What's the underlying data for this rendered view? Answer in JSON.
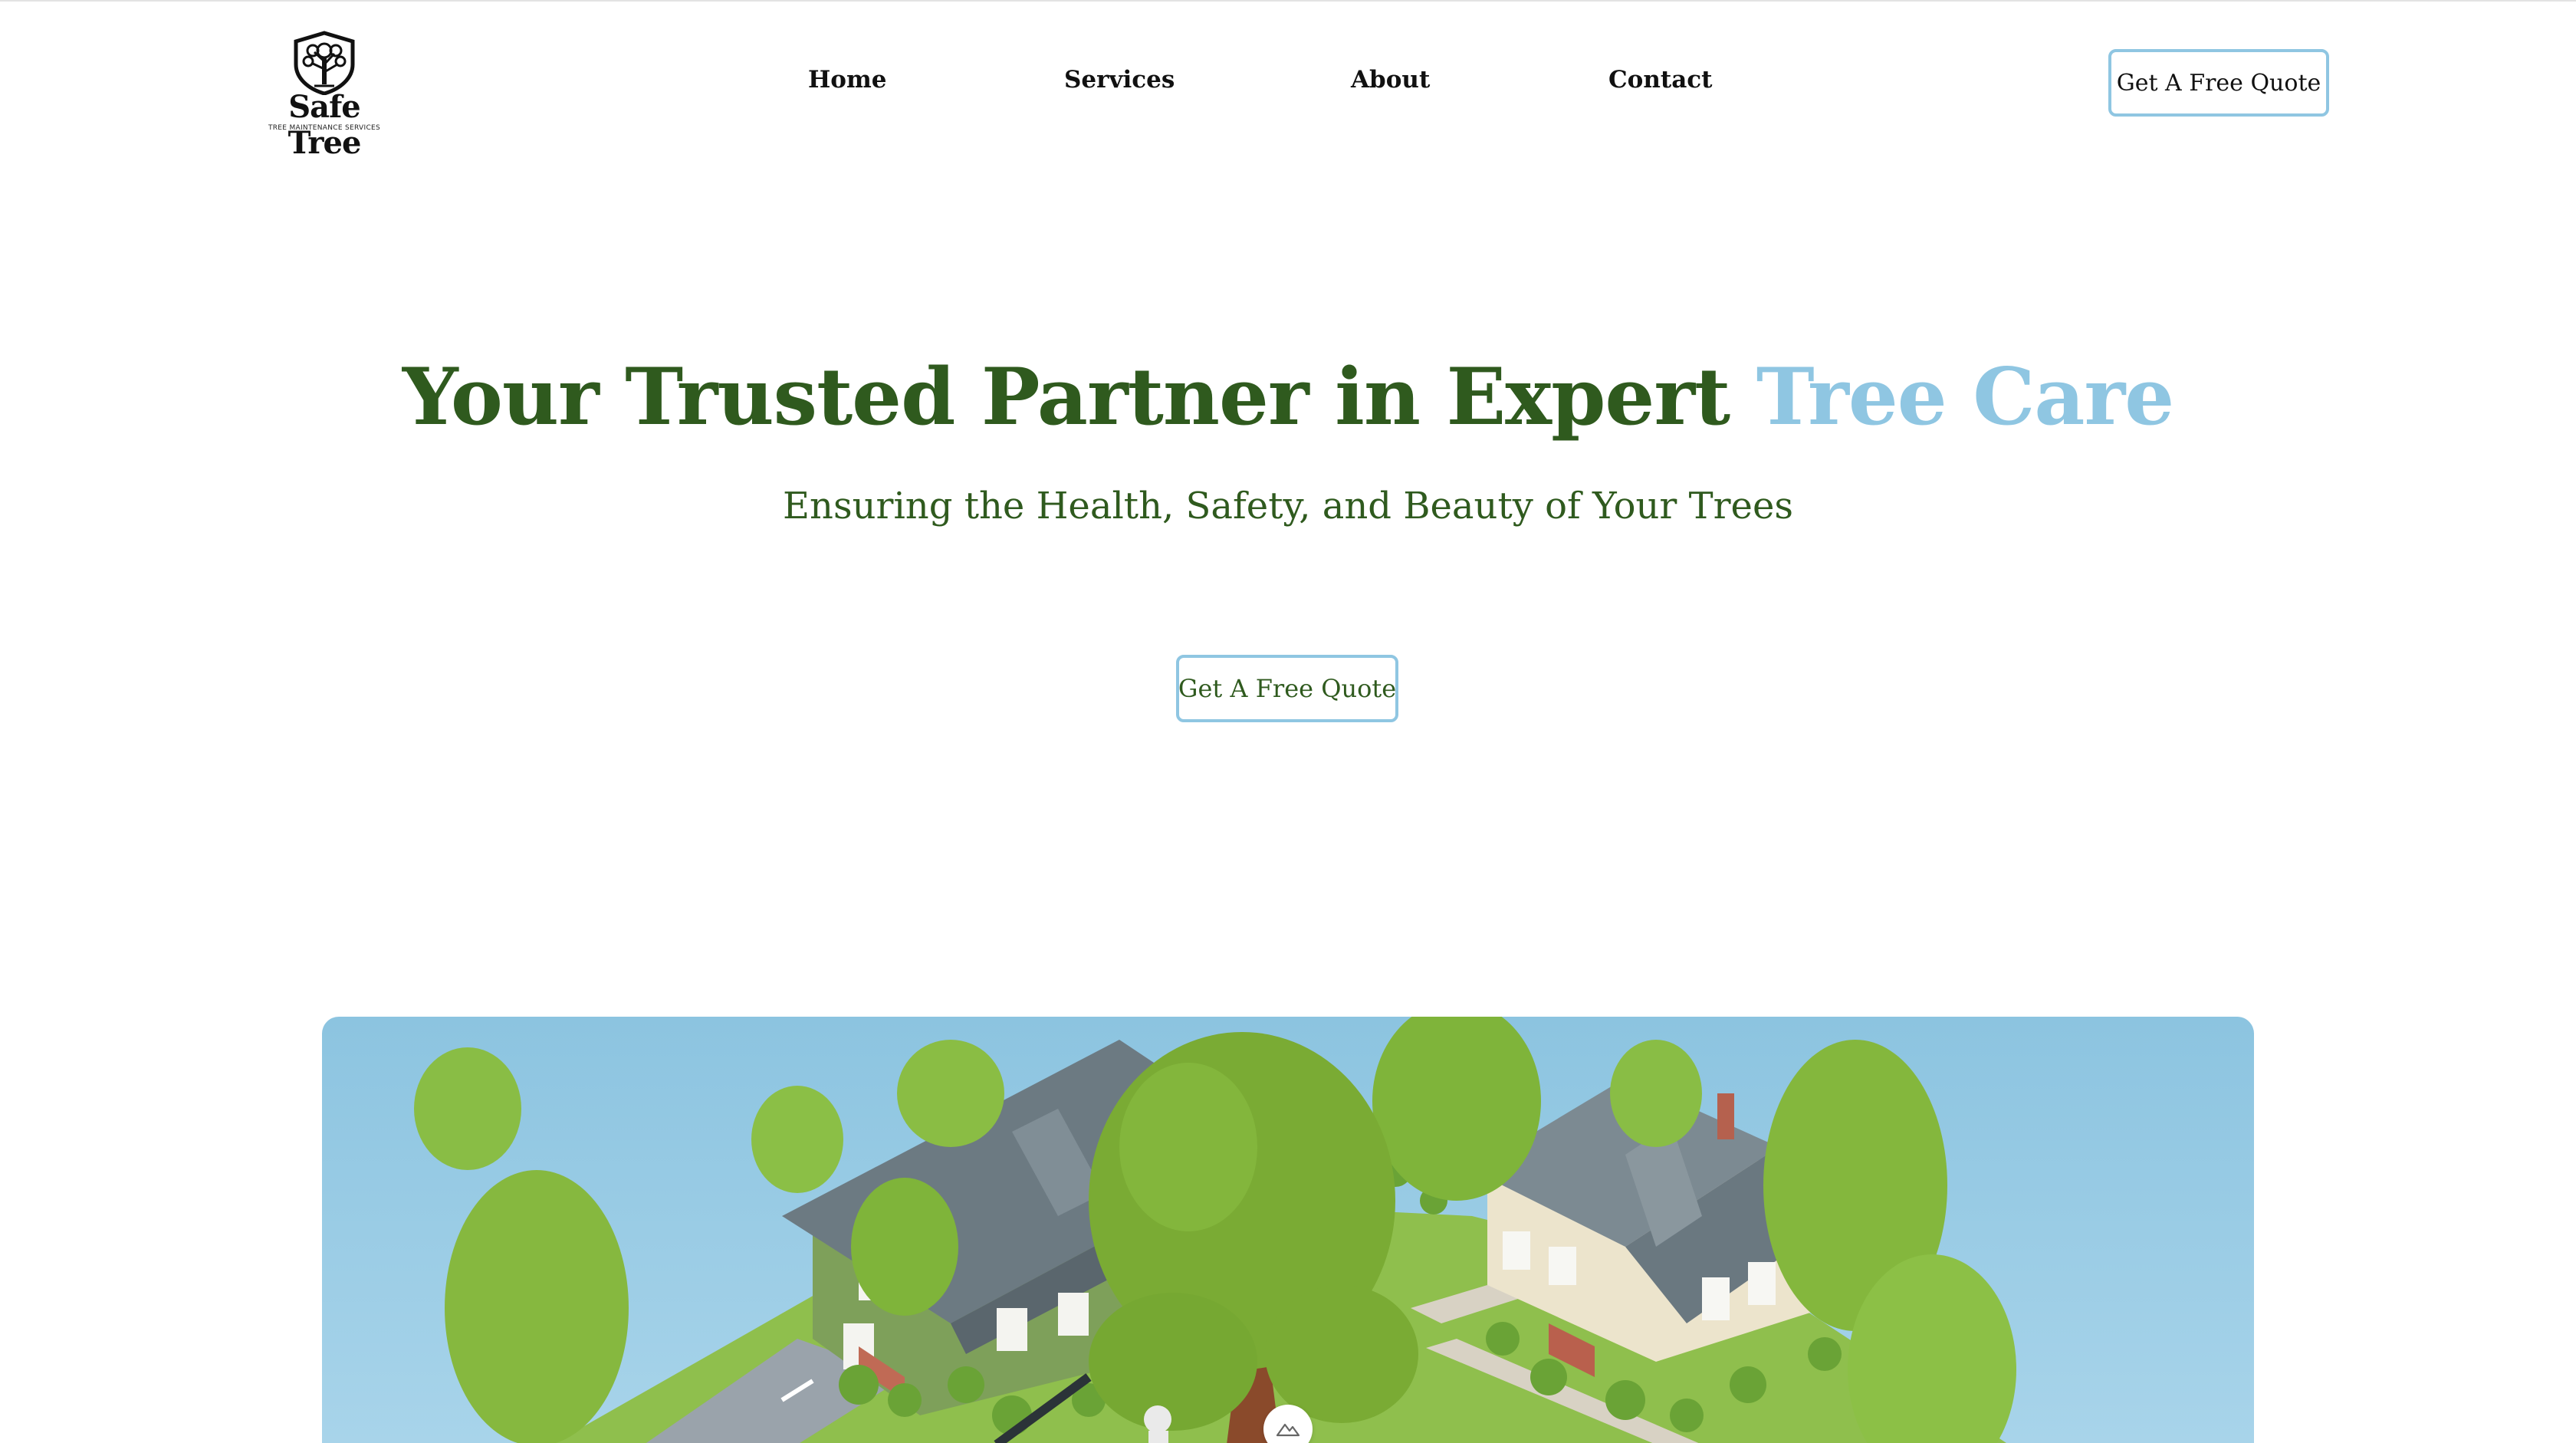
{
  "brand": {
    "name": "Safe Tree",
    "tagline": "TREE MAINTENANCE SERVICES"
  },
  "nav": {
    "home": "Home",
    "services": "Services",
    "about": "About",
    "contact": "Contact"
  },
  "header": {
    "cta_label": "Get A Free Quote"
  },
  "hero": {
    "title_main": "Your Trusted Partner in Expert ",
    "title_accent": "Tree Care",
    "subtitle": "Ensuring the Health, Safety, and Beauty of Your Trees",
    "cta_label": "Get A Free Quote"
  },
  "colors": {
    "primary_green": "#2f5a1e",
    "accent_blue": "#8fc6e2",
    "sky": "#8cc4e0"
  },
  "icons": {
    "logo": "tree-shield-icon",
    "scroll": "mountain-icon"
  }
}
